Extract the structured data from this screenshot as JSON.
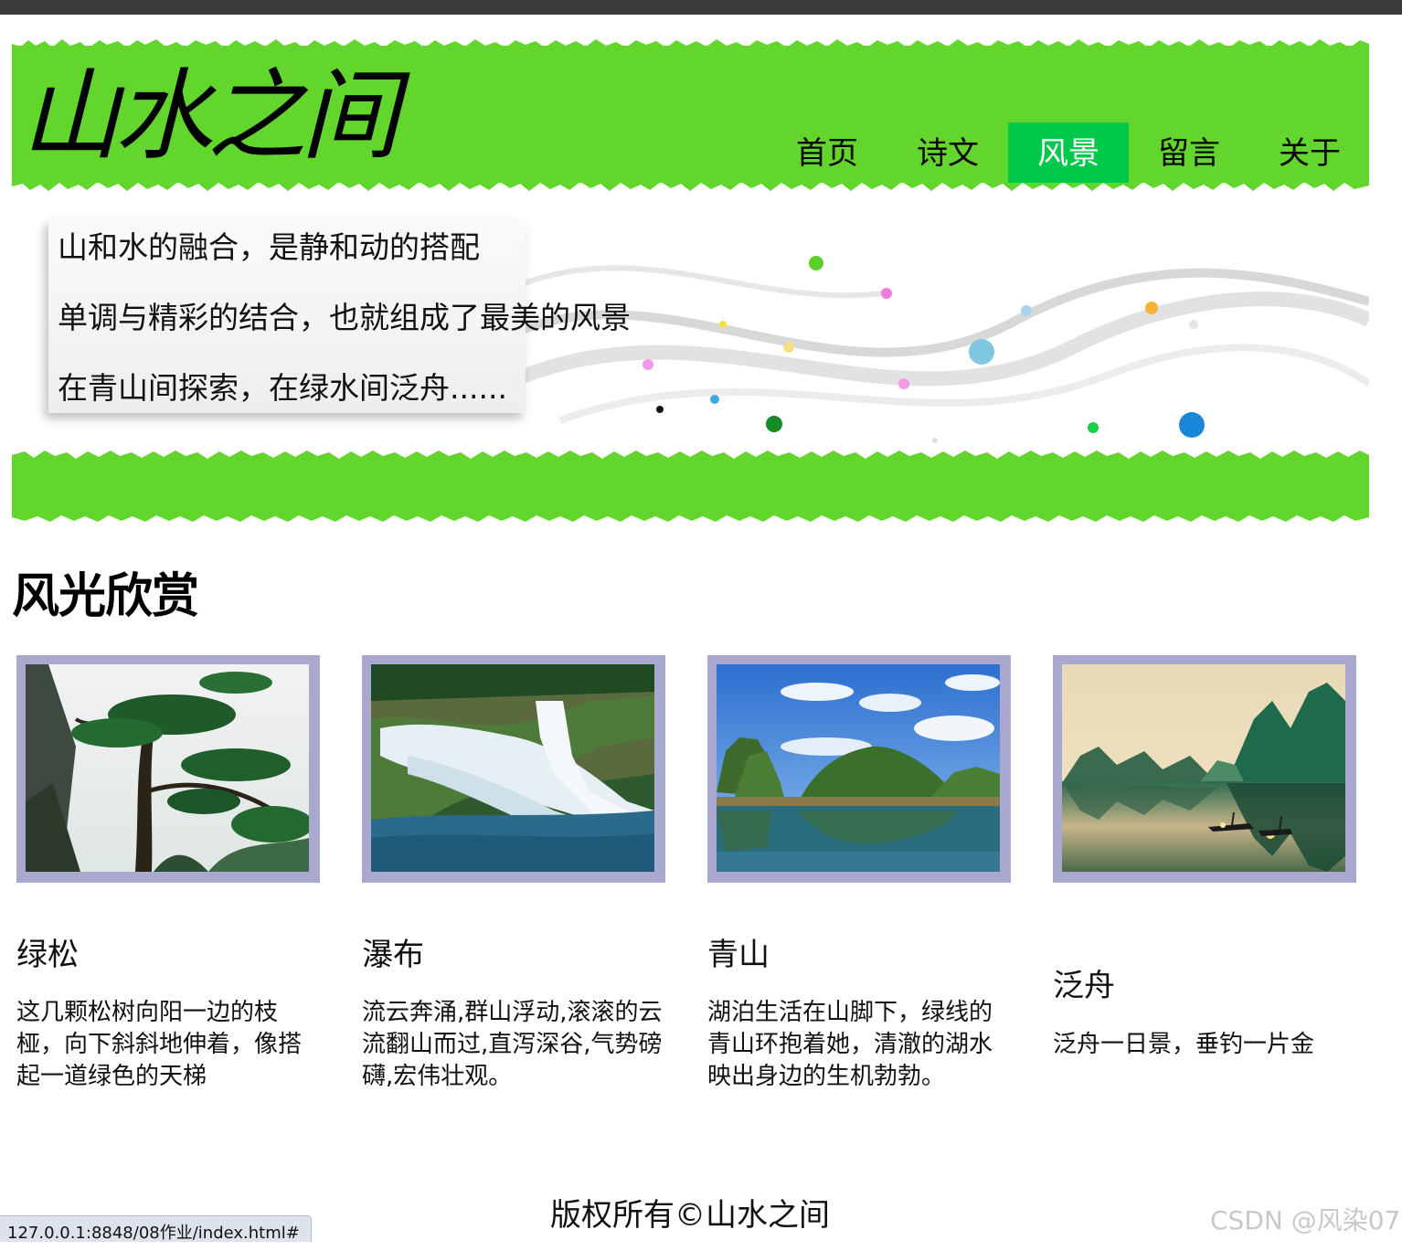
{
  "header": {
    "site_title": "山水之间",
    "nav": [
      {
        "label": "首页",
        "active": false
      },
      {
        "label": "诗文",
        "active": false
      },
      {
        "label": "风景",
        "active": true
      },
      {
        "label": "留言",
        "active": false
      },
      {
        "label": "关于",
        "active": false
      }
    ]
  },
  "banner": {
    "lines": [
      "山和水的融合，是静和动的搭配",
      "单调与精彩的结合，也就组成了最美的风景",
      "在青山间探索，在绿水间泛舟......"
    ]
  },
  "gallery": {
    "title": "风光欣赏",
    "items": [
      {
        "title": "绿松",
        "desc": "这几颗松树向阳一边的枝桠，向下斜斜地伸着，像搭起一道绿色的天梯",
        "image": "pine-tree-photo"
      },
      {
        "title": "瀑布",
        "desc": "流云奔涌,群山浮动,滚滚的云流翻山而过,直泻深谷,气势磅礴,宏伟壮观。",
        "image": "waterfall-photo"
      },
      {
        "title": "青山",
        "desc": "湖泊生活在山脚下，绿线的青山环抱着她，清澈的湖水映出身边的生机勃勃。",
        "image": "green-mountain-photo"
      },
      {
        "title": "泛舟",
        "desc": "泛舟一日景，垂钓一片金",
        "image": "boating-photo"
      }
    ]
  },
  "footer": {
    "copyright": "版权所有©山水之间"
  },
  "watermark": "CSDN @风染07",
  "statusbar": {
    "url": "127.0.0.1:8848/08作业/index.html#"
  },
  "colors": {
    "header_green": "#62d62c",
    "nav_active": "#00c84a",
    "frame": "#a9a9cf"
  }
}
